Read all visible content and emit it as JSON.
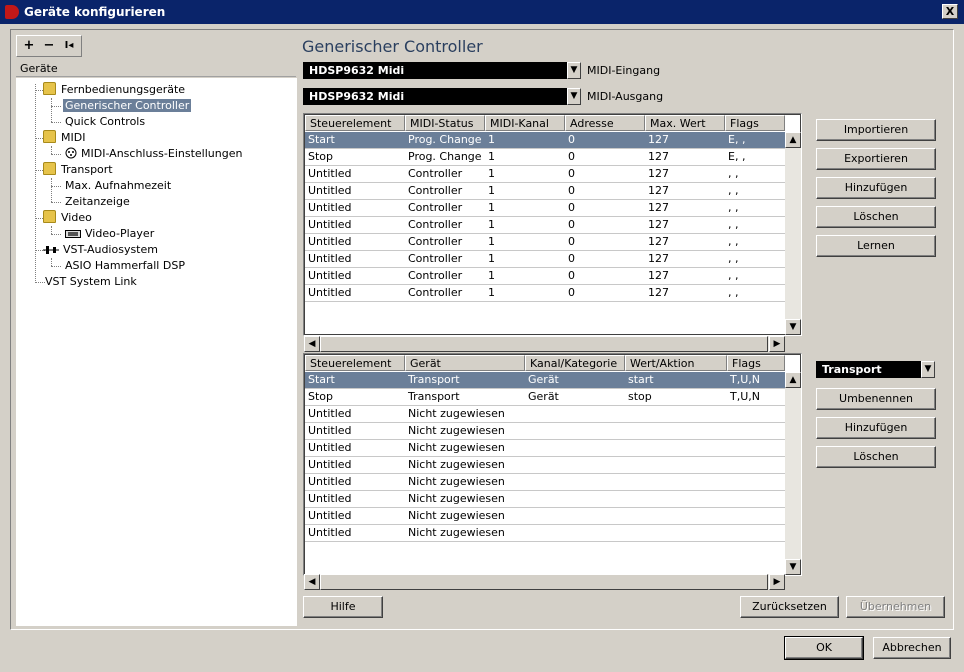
{
  "window": {
    "title": "Geräte konfigurieren",
    "close_label": "X"
  },
  "left": {
    "toolbar": {
      "add": "+",
      "remove": "−",
      "reset": "I◂"
    },
    "header": "Geräte",
    "tree": [
      {
        "label": "Fernbedienungsgeräte"
      },
      {
        "label": "Generischer Controller",
        "selected": true
      },
      {
        "label": "Quick Controls"
      },
      {
        "label": "MIDI"
      },
      {
        "label": "MIDI-Anschluss-Einstellungen"
      },
      {
        "label": "Transport"
      },
      {
        "label": "Max. Aufnahmezeit"
      },
      {
        "label": "Zeitanzeige"
      },
      {
        "label": "Video"
      },
      {
        "label": "Video-Player"
      },
      {
        "label": "VST-Audiosystem"
      },
      {
        "label": "ASIO Hammerfall DSP"
      },
      {
        "label": "VST System Link"
      }
    ]
  },
  "main": {
    "title": "Generischer Controller",
    "midi_in": {
      "value": "HDSP9632 Midi",
      "label": "MIDI-Eingang"
    },
    "midi_out": {
      "value": "HDSP9632 Midi",
      "label": "MIDI-Ausgang"
    },
    "table1": {
      "headers": [
        "Steuerelement",
        "MIDI-Status",
        "MIDI-Kanal",
        "Adresse",
        "Max. Wert",
        "Flags"
      ],
      "rows": [
        [
          "Start",
          "Prog. Change",
          "1",
          "0",
          "127",
          "E, ,"
        ],
        [
          "Stop",
          "Prog. Change",
          "1",
          "0",
          "127",
          "E, ,"
        ],
        [
          "Untitled",
          "Controller",
          "1",
          "0",
          "127",
          ", ,"
        ],
        [
          "Untitled",
          "Controller",
          "1",
          "0",
          "127",
          ", ,"
        ],
        [
          "Untitled",
          "Controller",
          "1",
          "0",
          "127",
          ", ,"
        ],
        [
          "Untitled",
          "Controller",
          "1",
          "0",
          "127",
          ", ,"
        ],
        [
          "Untitled",
          "Controller",
          "1",
          "0",
          "127",
          ", ,"
        ],
        [
          "Untitled",
          "Controller",
          "1",
          "0",
          "127",
          ", ,"
        ],
        [
          "Untitled",
          "Controller",
          "1",
          "0",
          "127",
          ", ,"
        ],
        [
          "Untitled",
          "Controller",
          "1",
          "0",
          "127",
          ", ,"
        ]
      ],
      "selected_row": 0
    },
    "table1_buttons": [
      "Importieren",
      "Exportieren",
      "Hinzufügen",
      "Löschen",
      "Lernen"
    ],
    "table2": {
      "headers": [
        "Steuerelement",
        "Gerät",
        "Kanal/Kategorie",
        "Wert/Aktion",
        "Flags"
      ],
      "rows": [
        [
          "Start",
          "Transport",
          "Gerät",
          "start",
          "T,U,N"
        ],
        [
          "Stop",
          "Transport",
          "Gerät",
          "stop",
          "T,U,N"
        ],
        [
          "Untitled",
          "Nicht zugewiesen",
          "",
          "",
          ""
        ],
        [
          "Untitled",
          "Nicht zugewiesen",
          "",
          "",
          ""
        ],
        [
          "Untitled",
          "Nicht zugewiesen",
          "",
          "",
          ""
        ],
        [
          "Untitled",
          "Nicht zugewiesen",
          "",
          "",
          ""
        ],
        [
          "Untitled",
          "Nicht zugewiesen",
          "",
          "",
          ""
        ],
        [
          "Untitled",
          "Nicht zugewiesen",
          "",
          "",
          ""
        ],
        [
          "Untitled",
          "Nicht zugewiesen",
          "",
          "",
          ""
        ],
        [
          "Untitled",
          "Nicht zugewiesen",
          "",
          "",
          ""
        ]
      ],
      "selected_row": 0
    },
    "bank_dropdown": {
      "value": "Transport"
    },
    "table2_buttons": [
      "Umbenennen",
      "Hinzufügen",
      "Löschen"
    ],
    "help_label": "Hilfe",
    "reset_label": "Zurücksetzen",
    "apply_label": "Übernehmen"
  },
  "footer": {
    "ok_label": "OK",
    "cancel_label": "Abbrechen"
  }
}
